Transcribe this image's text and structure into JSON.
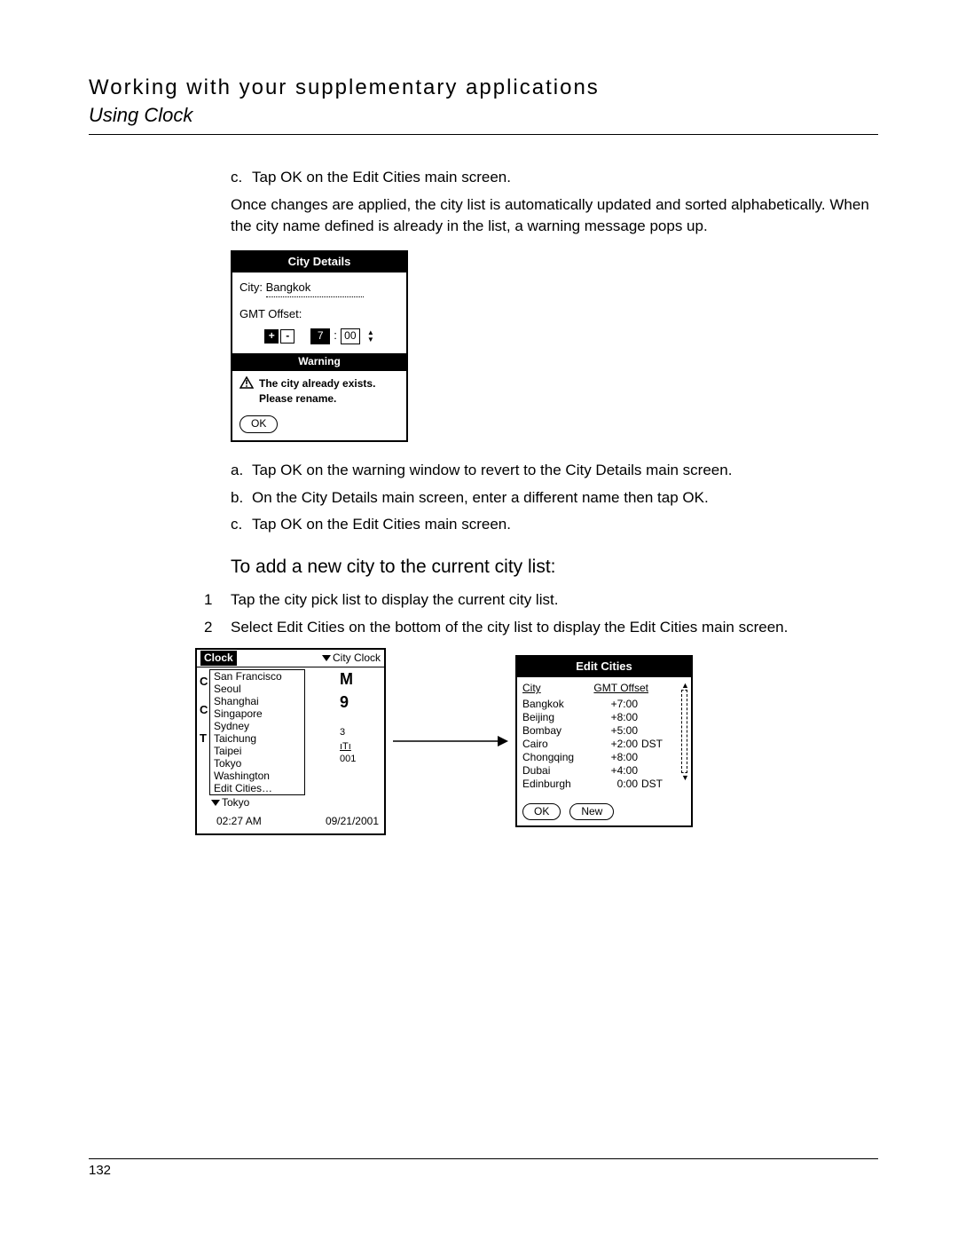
{
  "header": {
    "chapter": "Working with your supplementary applications",
    "section": "Using Clock"
  },
  "steps_top": {
    "c": "Tap OK on the Edit Cities main screen."
  },
  "para1": "Once changes are applied, the city list is automatically updated and sorted alphabetically. When the city name defined is already in the list, a warning message pops up.",
  "city_details": {
    "title": "City Details",
    "city_label": "City:",
    "city_value": "Bangkok",
    "gmt_label": "GMT Offset:",
    "plus": "+",
    "minus": "-",
    "hour": "7",
    "min": "00",
    "warning_title": "Warning",
    "warning_line1": "The city already exists.",
    "warning_line2": "Please rename.",
    "ok": "OK"
  },
  "steps_mid": {
    "a": "Tap OK on the warning window to revert to the City Details main screen.",
    "b": "On the City Details main screen, enter a different name then tap OK.",
    "c": "Tap OK on the Edit Cities main screen."
  },
  "h3": "To add a new city to the current city list:",
  "numlist": {
    "1": "Tap the city pick list to display the current city list.",
    "2": "Select Edit Cities on the bottom of the city list to display the Edit Cities main screen."
  },
  "clock": {
    "title": "Clock",
    "menu": "City Clock",
    "letters": [
      "C",
      "C",
      "T"
    ],
    "picklist": [
      "San Francisco",
      "Seoul",
      "Shanghai",
      "Singapore",
      "Sydney",
      "Taichung",
      "Taipei",
      "Tokyo",
      "Washington",
      "Edit Cities…"
    ],
    "right": {
      "l1": "M",
      "l2": "9",
      "l3": "",
      "l4": "3",
      "l5": "",
      "l6": "001"
    },
    "footer_city": "Tokyo",
    "time": "02:27 AM",
    "date": "09/21/2001"
  },
  "editcities": {
    "title": "Edit Cities",
    "col_city": "City",
    "col_gmt": "GMT Offset",
    "rows": [
      {
        "city": "Bangkok",
        "gmt": "+7:00",
        "dst": ""
      },
      {
        "city": "Beijing",
        "gmt": "+8:00",
        "dst": ""
      },
      {
        "city": "Bombay",
        "gmt": "+5:00",
        "dst": ""
      },
      {
        "city": "Cairo",
        "gmt": "+2:00",
        "dst": "DST"
      },
      {
        "city": "Chongqing",
        "gmt": "+8:00",
        "dst": ""
      },
      {
        "city": "Dubai",
        "gmt": "+4:00",
        "dst": ""
      },
      {
        "city": "Edinburgh",
        "gmt": "0:00",
        "dst": "DST"
      }
    ],
    "ok": "OK",
    "new": "New"
  },
  "page_number": "132"
}
